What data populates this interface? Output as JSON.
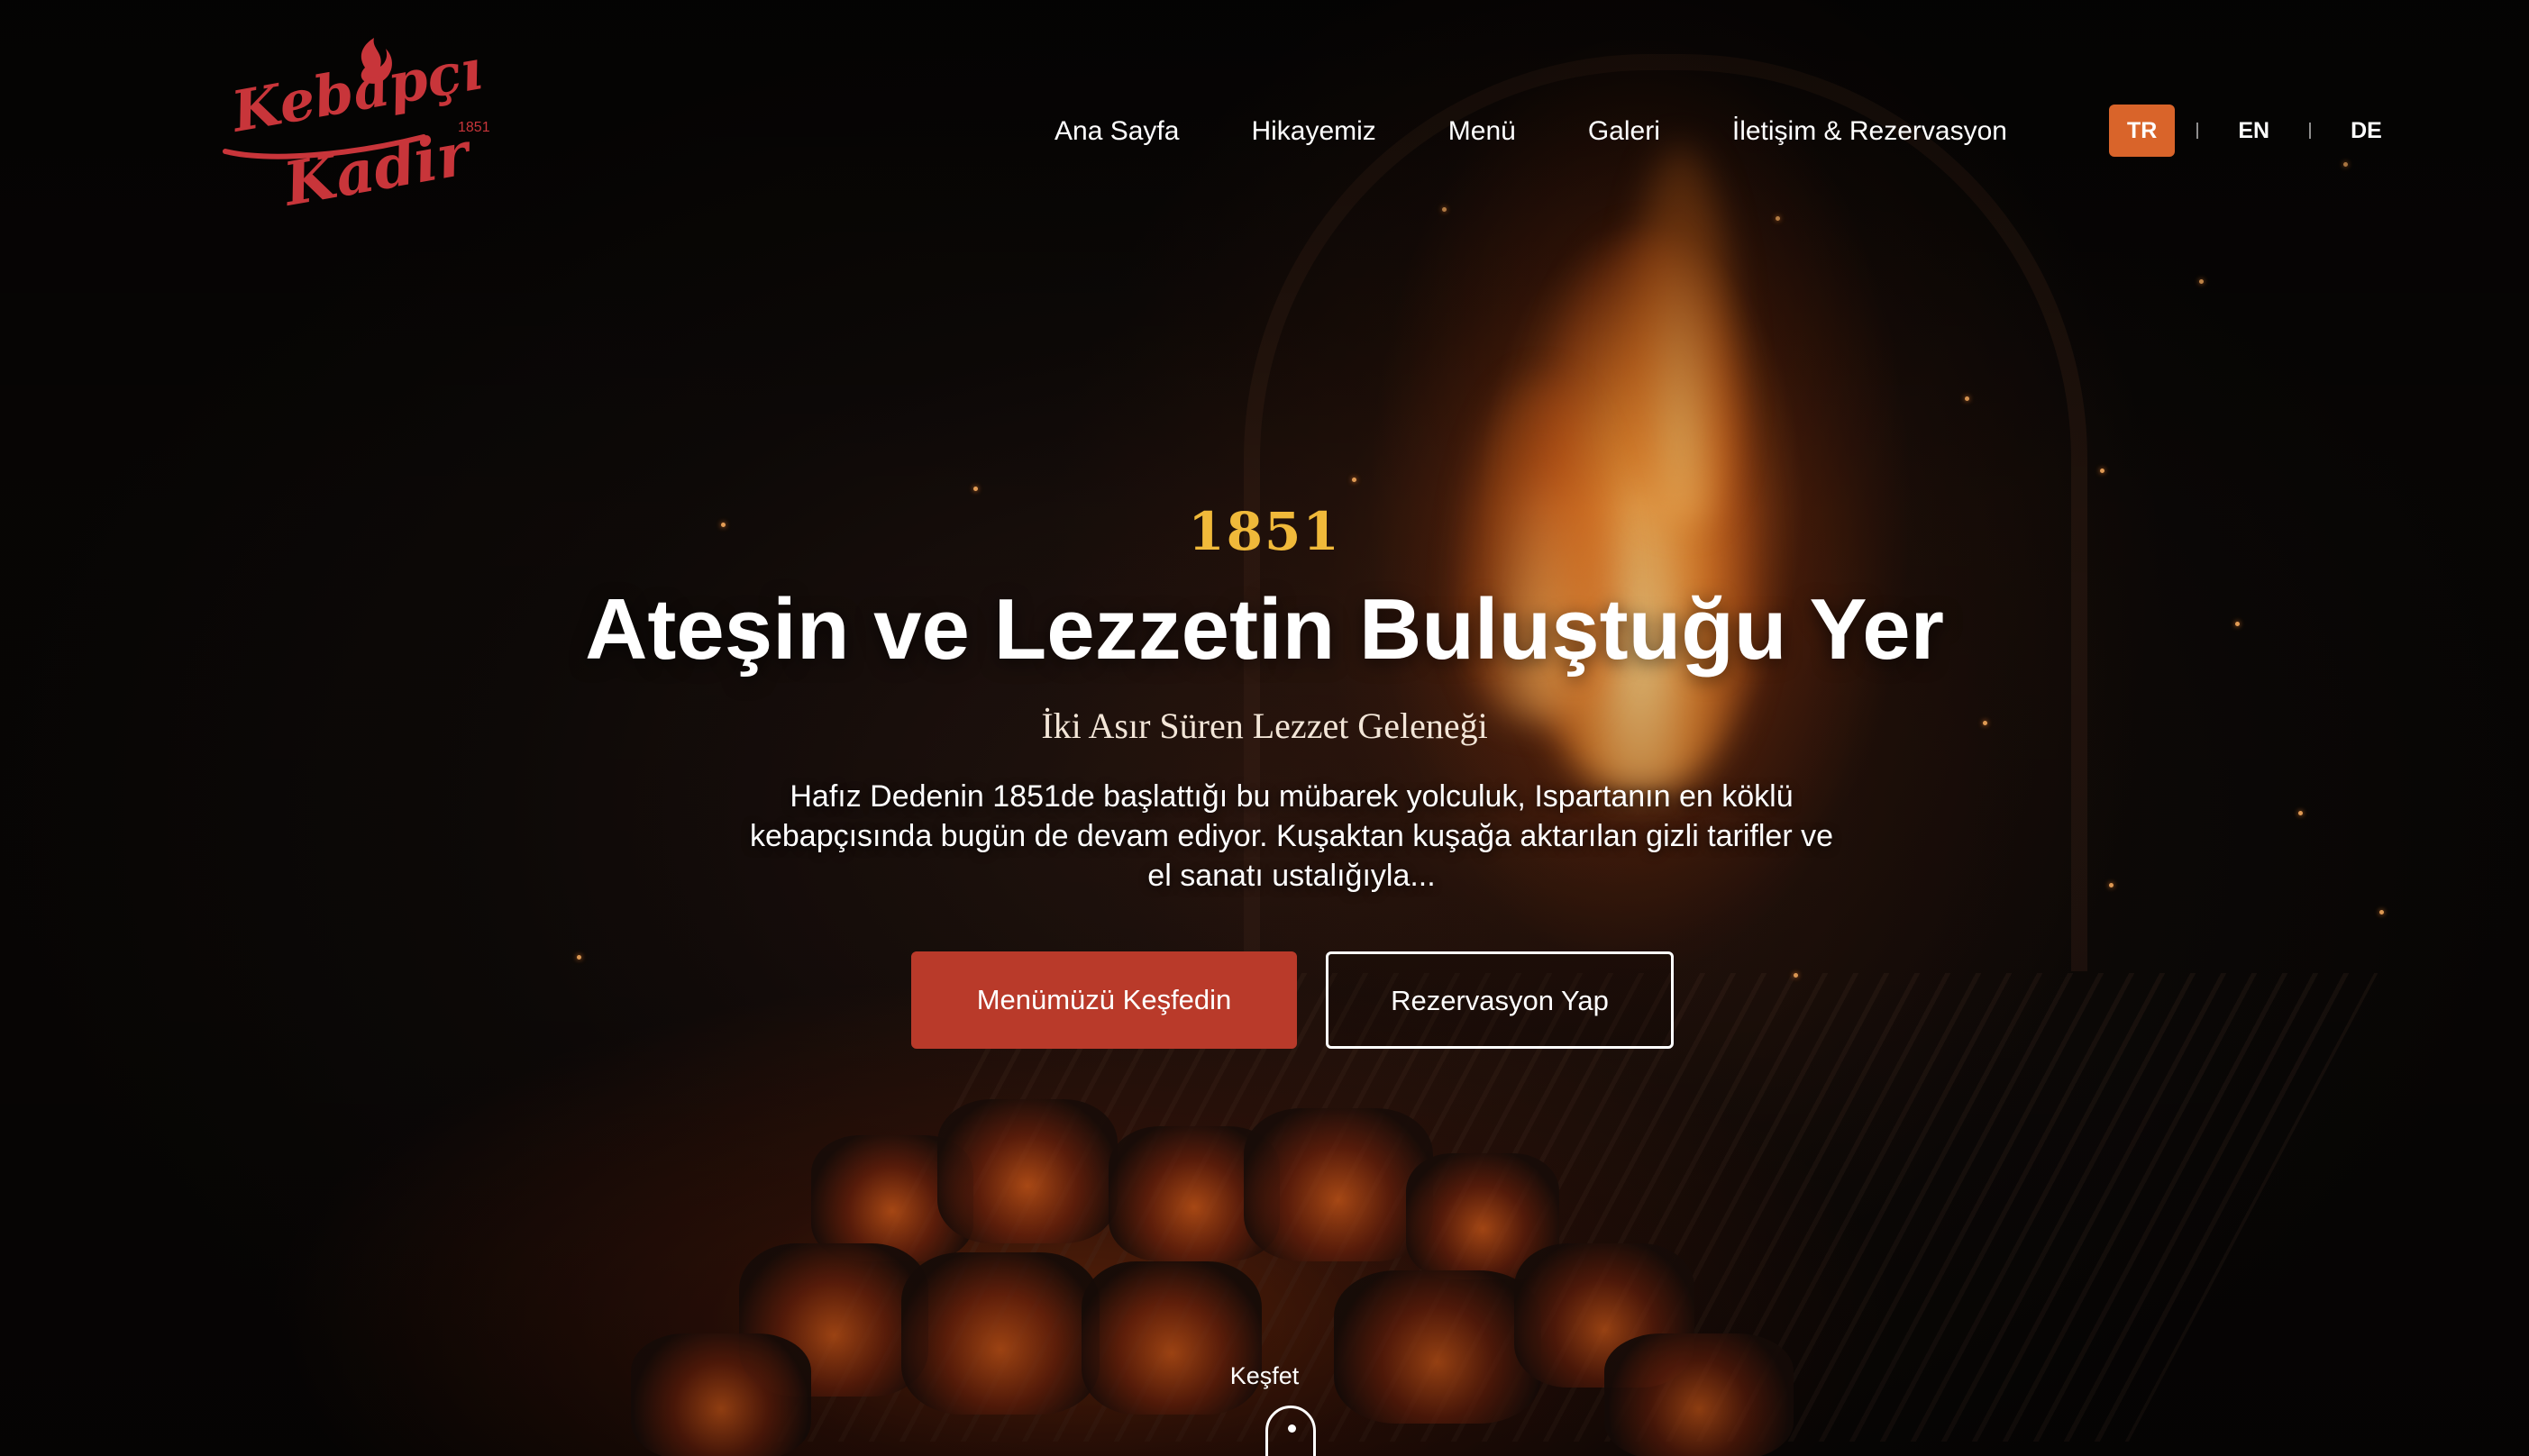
{
  "brand": {
    "logo_line1": "Kebapçı",
    "logo_line2": "Kadir",
    "logo_year": "1851",
    "logo_color": "#c8353a"
  },
  "nav": {
    "items": [
      {
        "label": "Ana Sayfa"
      },
      {
        "label": "Hikayemiz"
      },
      {
        "label": "Menü"
      },
      {
        "label": "Galeri"
      },
      {
        "label": "İletişim & Rezervasyon"
      }
    ]
  },
  "languages": {
    "options": [
      {
        "label": "TR",
        "active": true
      },
      {
        "label": "EN",
        "active": false
      },
      {
        "label": "DE",
        "active": false
      }
    ],
    "active_color": "#d9642a"
  },
  "hero": {
    "year": "1851",
    "title": "Ateşin ve Lezzetin Buluştuğu Yer",
    "subtitle": "İki Asır Süren Lezzet Geleneği",
    "description": "Hafız Dedenin 1851de başlattığı bu mübarek yolculuk, Ispartanın en köklü kebapçısında bugün de devam ediyor. Kuşaktan kuşağa aktarılan gizli tarifler ve el sanatı ustalığıyla...",
    "primary_button": "Menümüzü Keşfedin",
    "secondary_button": "Rezervasyon Yap",
    "scroll_label": "Keşfet",
    "year_color": "#f0b93a",
    "primary_color": "#b93a2a"
  }
}
